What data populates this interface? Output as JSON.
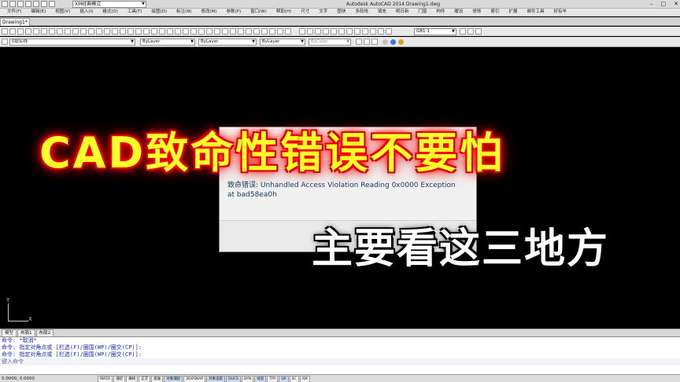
{
  "titlebar": {
    "workspace": "XM经典模式",
    "app_title": "Autodesk AutoCAD 2014    Drawing1.dwg"
  },
  "menubar": {
    "items": [
      "文件(F)",
      "编辑(E)",
      "视图(V)",
      "插入(I)",
      "格式(O)",
      "工具(T)",
      "绘图(D)",
      "标注(N)",
      "修改(M)",
      "参数(P)",
      "窗口(W)",
      "帮助(H)",
      "尺寸",
      "文字",
      "图块",
      "多段线",
      "填充",
      "明日新",
      "门窗",
      "构件",
      "暖设",
      "修饰",
      "索引",
      "扩展",
      "邮件工具",
      "好有羊"
    ]
  },
  "tabs": {
    "doc": "Drawing1*"
  },
  "toolbar": {
    "layer": "0层实线",
    "color": "ByLayer",
    "linetype": "ByLayer",
    "lineweight": "ByLayer",
    "plotstyle": "ByColor",
    "dimstyle": "GB1-1"
  },
  "dialog": {
    "message": "致命错误: Unhandled Access Violation Reading 0x0000 Exception at bad58ea0h"
  },
  "overlay": {
    "headline": "CAD致命性错误不要怕",
    "subline": "主要看这三地方"
  },
  "ucs": {
    "y": "Y",
    "x": "X"
  },
  "layout_tabs": [
    "模型",
    "布局1",
    "布局2"
  ],
  "command": {
    "lines": [
      "命令: *取消*",
      "命令: 指定对角点或 [栏选(F)/圈围(WP)/圈交(CP)]:",
      "命令: 指定对角点或 [栏选(F)/圈围(WP)/圈交(CP)]:"
    ],
    "prompt": "键入命令"
  },
  "status": {
    "coords": "0.0000, 0.0000",
    "buttons": [
      "INFER",
      "捕捉",
      "栅格",
      "正交",
      "极轴",
      "对象捕捉",
      "3DOSNAP",
      "对象追踪",
      "DUCS",
      "DYN",
      "线宽",
      "TPY",
      "QP",
      "SC",
      "AM"
    ]
  },
  "colors": {
    "headline": "#ffff2a",
    "glow": "#ff0000",
    "canvas": "#000000"
  }
}
